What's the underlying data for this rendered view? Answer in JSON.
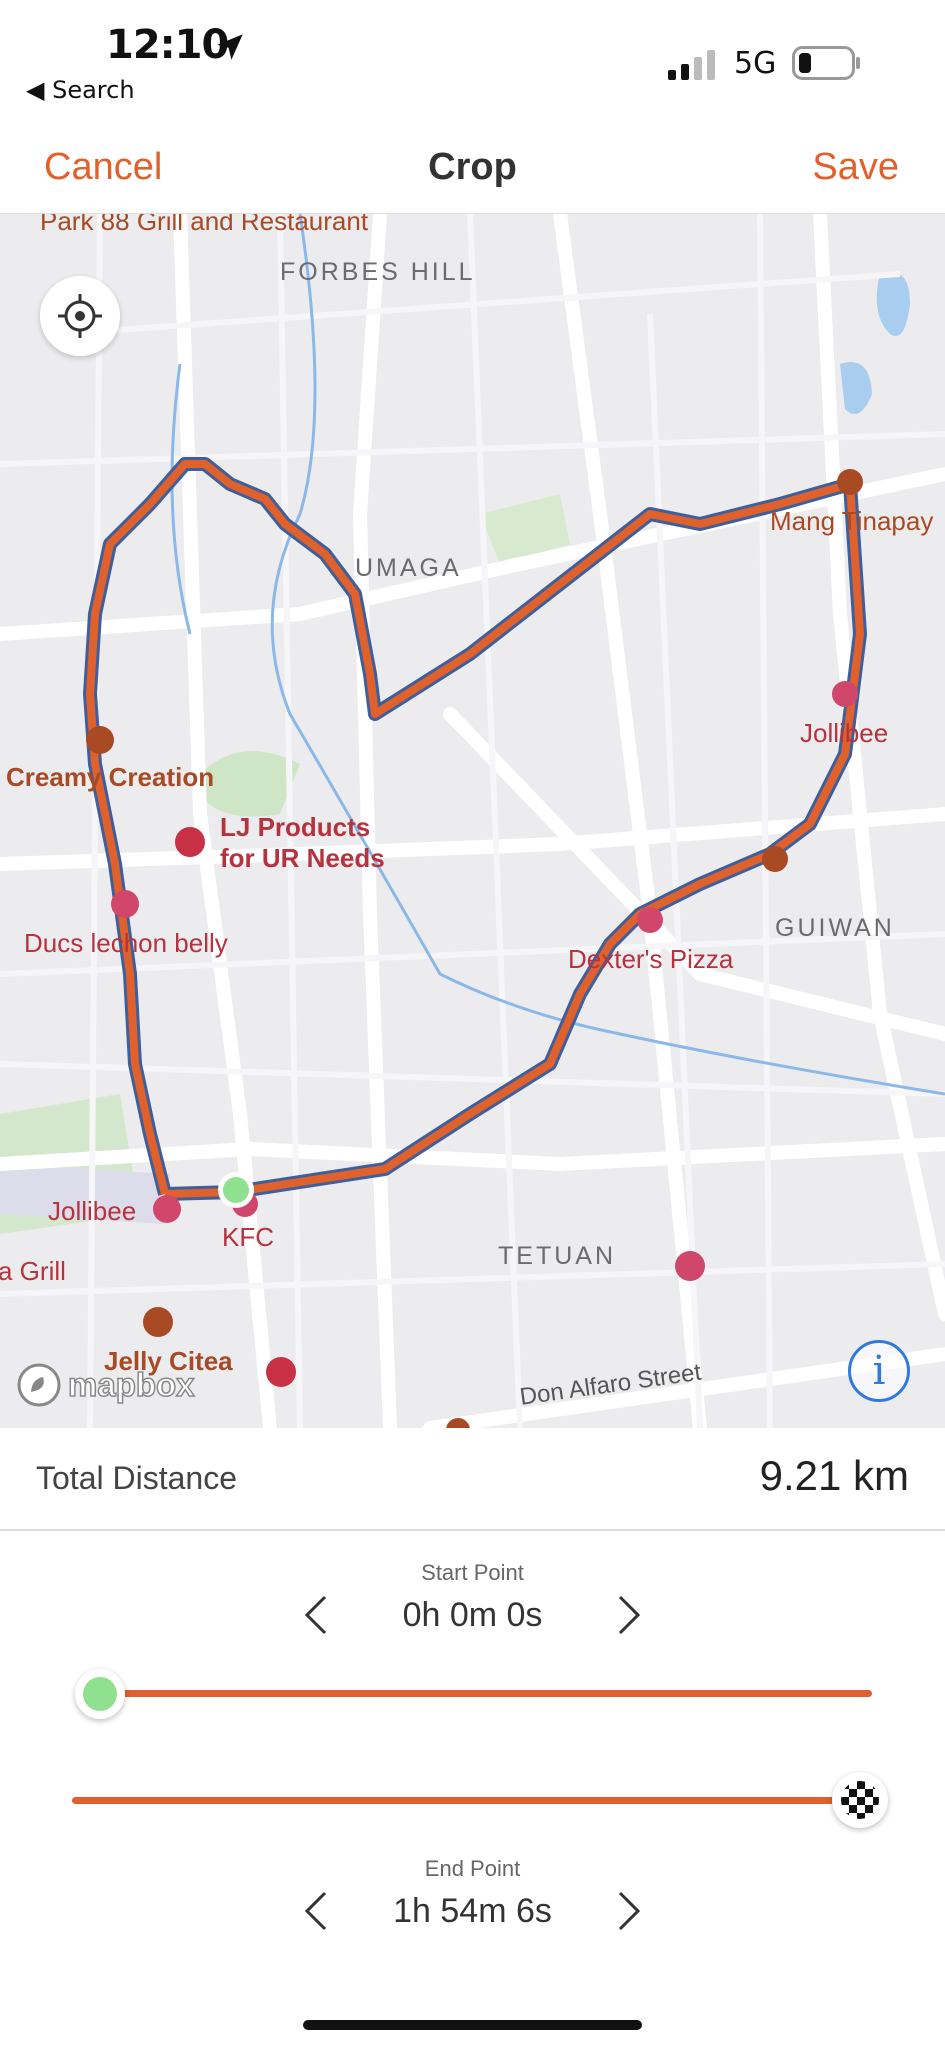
{
  "status_bar": {
    "time": "12:10",
    "back_label": "◀ Search",
    "network": "5G"
  },
  "nav": {
    "cancel": "Cancel",
    "title": "Crop",
    "save": "Save"
  },
  "map": {
    "areas": [
      "FORBES HILL",
      "UMAGA",
      "GUIWAN",
      "TETUAN"
    ],
    "pois": [
      {
        "name": "Park 88 Grill and Restaurant",
        "color": "#a84a24"
      },
      {
        "name": "Mang Tinapay",
        "color": "#a84a24"
      },
      {
        "name": "Jollibee",
        "color": "#b7323f"
      },
      {
        "name": "Creamy Creation",
        "color": "#a84a24"
      },
      {
        "name": "LJ Products for UR Needs",
        "color": "#b7323f"
      },
      {
        "name": "Ducs lechon belly",
        "color": "#b7323f"
      },
      {
        "name": "Dexter's Pizza",
        "color": "#b7323f"
      },
      {
        "name": "Jollibee",
        "color": "#b7323f"
      },
      {
        "name": "KFC",
        "color": "#b7323f"
      },
      {
        "name": "a Grill",
        "color": "#b7323f"
      },
      {
        "name": "Jelly Citea",
        "color": "#a84a24"
      }
    ],
    "streets": [
      "Don Alfaro Street"
    ],
    "attribution": "mapbox",
    "route_color": "#e0612c"
  },
  "summary": {
    "label": "Total Distance",
    "value": "9.21 km"
  },
  "start_point": {
    "caption": "Start Point",
    "value": "0h 0m 0s",
    "position": 0
  },
  "end_point": {
    "caption": "End Point",
    "value": "1h 54m 6s",
    "position": 1
  },
  "colors": {
    "accent": "#e0612c",
    "start_marker": "#8fe08f",
    "info": "#2f7ae0"
  }
}
